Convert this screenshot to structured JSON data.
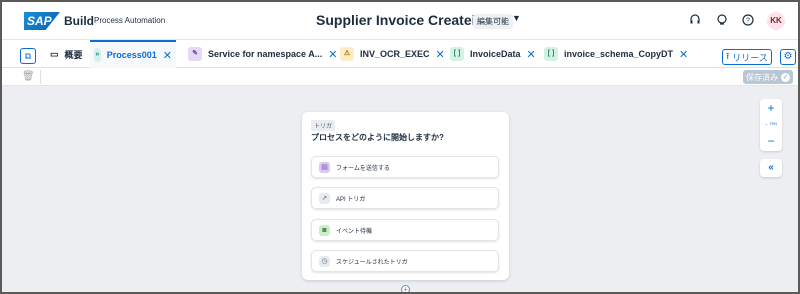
{
  "shell": {
    "logo": "SAP",
    "app_name": "Build",
    "app_sub": "Process Automation",
    "project_title": "Supplier Invoice Createion",
    "edit_badge": "編集可能",
    "avatar": "KK"
  },
  "tabs": {
    "overview": "概要",
    "process": "Process001",
    "service": "Service for namespace A...",
    "inv_ocr": "INV_OCR_EXEC",
    "invoice_data": "InvoiceData",
    "invoice_schema": "invoice_schema_CopyDT"
  },
  "actions": {
    "release": "リリース"
  },
  "toolbar": {
    "saved": "保存済み"
  },
  "trigger_card": {
    "tag": "トリガ",
    "question": "プロセスをどのように開始しますか?",
    "options": [
      {
        "label": "フォームを送信する",
        "icon": "form-icon",
        "color": "#d9c8f0"
      },
      {
        "label": "API トリガ",
        "icon": "api-rocket-icon",
        "color": "#e8ebee"
      },
      {
        "label": "イベント待機",
        "icon": "event-icon",
        "color": "#cdeccf"
      },
      {
        "label": "スケジュールされたトリガ",
        "icon": "schedule-icon",
        "color": "#e8ebee"
      }
    ]
  },
  "zoom": {
    "level": "75%"
  },
  "colors": {
    "accent": "#0a6ed1",
    "canvas": "#eceef1"
  }
}
